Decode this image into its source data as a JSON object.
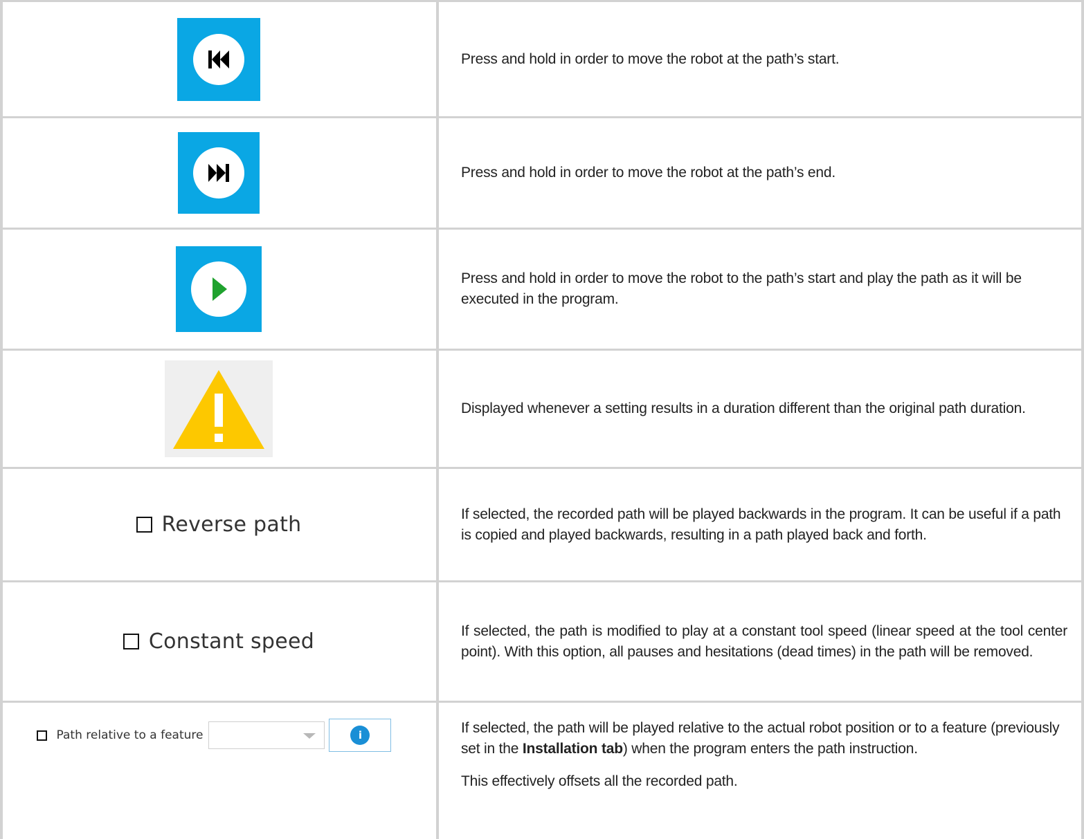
{
  "rows": [
    {
      "icon": "skip-to-start-icon",
      "description": "Press and hold in order to move the robot at the path’s start."
    },
    {
      "icon": "skip-to-end-icon",
      "description": "Press and hold in order to move the robot at the path’s end."
    },
    {
      "icon": "play-icon",
      "description": "Press and hold in order to move the robot to the path’s start and play the path as it will be executed in the program."
    },
    {
      "icon": "warning-icon",
      "description": "Displayed whenever a setting results in a duration different than the original path duration."
    },
    {
      "checkbox_label": "Reverse path",
      "description": "If selected, the recorded path will be played backwards in the program. It can be useful if a path is copied and played backwards, resulting in a path played back and forth."
    },
    {
      "checkbox_label": "Constant speed",
      "description": "If selected, the path is modified to play at a constant tool speed (linear speed at the tool center point). With this option, all pauses and hesitations (dead times) in the path will be removed."
    },
    {
      "checkbox_label": "Path relative to a feature",
      "dropdown_value": "",
      "info_icon": "i",
      "description_before": "If selected, the path will be played relative to the actual robot position or to a feature (previously set in the ",
      "description_bold": "Installation tab",
      "description_after": ") when the program enters the path instruction.",
      "description_extra": "This effectively offsets all the recorded path."
    }
  ],
  "colors": {
    "button_blue": "#0aa7e4",
    "warning_yellow": "#fdc800",
    "play_green": "#1fa22e",
    "info_blue": "#1a8fd6",
    "grid_gray": "#d2d2d2"
  }
}
